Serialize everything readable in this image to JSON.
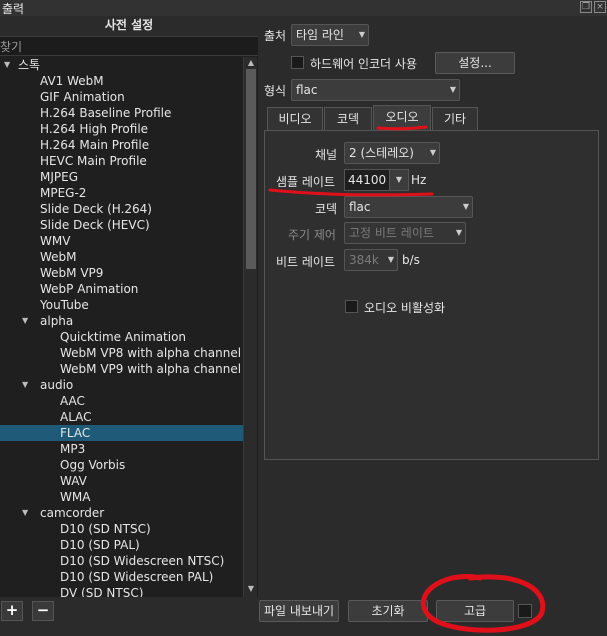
{
  "window": {
    "title": "출력",
    "float_icon": "float-icon",
    "close_icon": "close-icon"
  },
  "presets": {
    "header": "사전 설정",
    "search_placeholder": "찾기",
    "tree": [
      {
        "label": "스톡",
        "level": 0,
        "expanded": true
      },
      {
        "label": "AV1 WebM",
        "level": 1
      },
      {
        "label": "GIF Animation",
        "level": 1
      },
      {
        "label": "H.264 Baseline Profile",
        "level": 1
      },
      {
        "label": "H.264 High Profile",
        "level": 1
      },
      {
        "label": "H.264 Main Profile",
        "level": 1
      },
      {
        "label": "HEVC Main Profile",
        "level": 1
      },
      {
        "label": "MJPEG",
        "level": 1
      },
      {
        "label": "MPEG-2",
        "level": 1
      },
      {
        "label": "Slide Deck (H.264)",
        "level": 1
      },
      {
        "label": "Slide Deck (HEVC)",
        "level": 1
      },
      {
        "label": "WMV",
        "level": 1
      },
      {
        "label": "WebM",
        "level": 1
      },
      {
        "label": "WebM VP9",
        "level": 1
      },
      {
        "label": "WebP Animation",
        "level": 1
      },
      {
        "label": "YouTube",
        "level": 1
      },
      {
        "label": "alpha",
        "level": 1,
        "expanded": true
      },
      {
        "label": "Quicktime Animation",
        "level": 2
      },
      {
        "label": "WebM VP8 with alpha channel",
        "level": 2
      },
      {
        "label": "WebM VP9 with alpha channel",
        "level": 2
      },
      {
        "label": "audio",
        "level": 1,
        "expanded": true
      },
      {
        "label": "AAC",
        "level": 2
      },
      {
        "label": "ALAC",
        "level": 2
      },
      {
        "label": "FLAC",
        "level": 2,
        "selected": true
      },
      {
        "label": "MP3",
        "level": 2
      },
      {
        "label": "Ogg Vorbis",
        "level": 2
      },
      {
        "label": "WAV",
        "level": 2
      },
      {
        "label": "WMA",
        "level": 2
      },
      {
        "label": "camcorder",
        "level": 1,
        "expanded": true
      },
      {
        "label": "D10 (SD NTSC)",
        "level": 2
      },
      {
        "label": "D10 (SD PAL)",
        "level": 2
      },
      {
        "label": "D10 (SD Widescreen NTSC)",
        "level": 2
      },
      {
        "label": "D10 (SD Widescreen PAL)",
        "level": 2
      },
      {
        "label": "DV (SD NTSC)",
        "level": 2
      }
    ],
    "add_label": "+",
    "remove_label": "−"
  },
  "settings": {
    "source_label": "출처",
    "source_value": "타임 라인",
    "hw_encoder_label": "하드웨어 인코더 사용",
    "hw_settings_button": "설정...",
    "format_label": "형식",
    "format_value": "flac",
    "tabs": [
      "비디오",
      "코덱",
      "오디오",
      "기타"
    ],
    "active_tab": 2,
    "audio": {
      "channels_label": "채널",
      "channels_value": "2 (스테레오)",
      "sample_rate_label": "샘플 레이트",
      "sample_rate_value": "44100",
      "sample_rate_unit": "Hz",
      "codec_label": "코덱",
      "codec_value": "flac",
      "rate_control_label": "주기 제어",
      "rate_control_value": "고정 비트 레이트",
      "bitrate_label": "비트 레이트",
      "bitrate_value": "384k",
      "bitrate_unit": "b/s",
      "disable_audio_label": "오디오 비활성화"
    }
  },
  "footer": {
    "export_file_button": "파일 내보내기",
    "reset_button": "초기화",
    "advanced_button": "고급"
  },
  "colors": {
    "selection": "#1f5a78",
    "annotation": "#e0101a",
    "background": "#2b2b2b"
  }
}
